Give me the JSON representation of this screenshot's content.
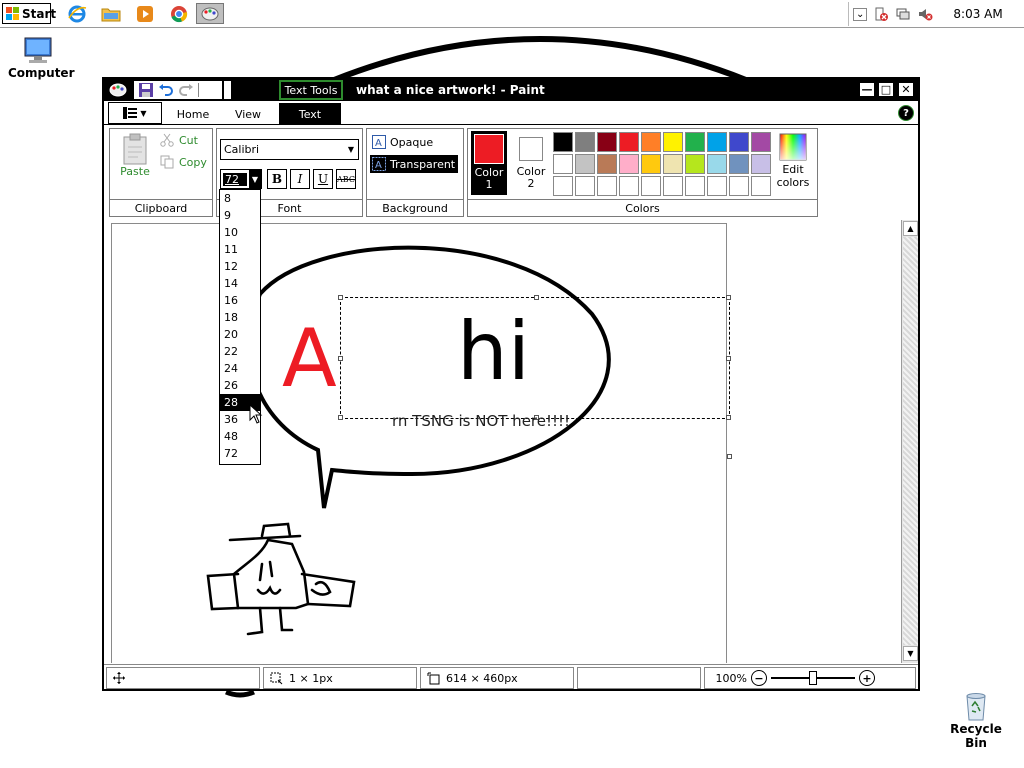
{
  "taskbar": {
    "start_label": "Start",
    "clock": "8:03 AM"
  },
  "desktop": {
    "computer_label": "Computer",
    "recycle_label": "Recycle Bin"
  },
  "window": {
    "title": "what a nice artwork! - Paint",
    "context_tab": "Text Tools",
    "tabs": [
      "Home",
      "View",
      "Text"
    ],
    "active_tab": "Text"
  },
  "ribbon": {
    "clipboard": {
      "paste": "Paste",
      "cut": "Cut",
      "copy": "Copy",
      "label": "Clipboard"
    },
    "font": {
      "family": "Calibri",
      "size": "72",
      "bold": "B",
      "italic": "I",
      "underline": "U",
      "strike": "ABC",
      "label": "Font"
    },
    "background": {
      "opaque": "Opaque",
      "transparent": "Transparent",
      "label": "Background"
    },
    "colors": {
      "color1_label": "Color 1",
      "color2_label": "Color 2",
      "color1": "#ed1c24",
      "color2": "#ffffff",
      "edit_label": "Edit colors",
      "label": "Colors",
      "palette_row1": [
        "#000000",
        "#7f7f7f",
        "#880015",
        "#ed1c24",
        "#ff7f27",
        "#fff200",
        "#22b14c",
        "#00a2e8",
        "#3f48cc",
        "#a349a4"
      ],
      "palette_row2": [
        "#ffffff",
        "#c3c3c3",
        "#b97a57",
        "#ffaec9",
        "#ffc90e",
        "#efe4b0",
        "#b5e61d",
        "#99d9ea",
        "#7092be",
        "#c8bfe7"
      ],
      "palette_row3": [
        "#ffffff",
        "#ffffff",
        "#ffffff",
        "#ffffff",
        "#ffffff",
        "#ffffff",
        "#ffffff",
        "#ffffff",
        "#ffffff",
        "#ffffff"
      ]
    }
  },
  "font_sizes": {
    "items": [
      "8",
      "9",
      "10",
      "11",
      "12",
      "14",
      "16",
      "18",
      "20",
      "22",
      "24",
      "26",
      "28",
      "36",
      "48",
      "72"
    ],
    "highlighted": "28"
  },
  "canvas": {
    "letter_a": "A",
    "hi_text": "hi",
    "small_text": "rn TSNG is NOT here!!!!",
    "accent": "#ed1c24"
  },
  "status": {
    "selection_size": "1 × 1px",
    "canvas_size": "614 × 460px",
    "zoom": "100%",
    "zoom_fraction": 0.5
  }
}
